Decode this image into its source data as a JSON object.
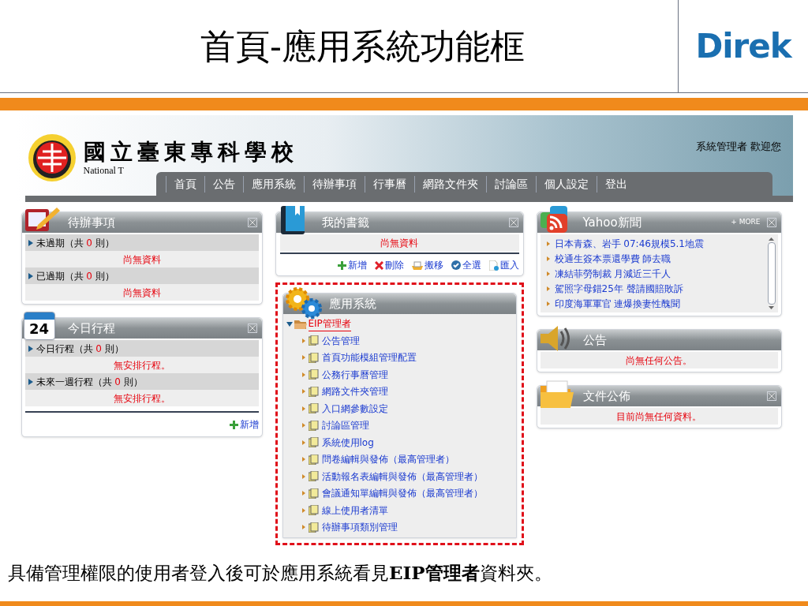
{
  "slide": {
    "title": "首頁-應用系統功能框",
    "logo": "Direk",
    "caption": "具備管理權限的使用者登入後可於應用系統看見**EIP管理者**資料夾。"
  },
  "header": {
    "school_name": "國立臺東專科學校",
    "school_name_en": "National T",
    "welcome": "系統管理者 歡迎您",
    "nav": [
      "首頁",
      "公告",
      "應用系統",
      "待辦事項",
      "行事曆",
      "網路文件夾",
      "討論區",
      "個人設定",
      "登出"
    ]
  },
  "todo": {
    "title": "待辦事項",
    "sections": [
      {
        "prefix": "未過期（共 ",
        "count": "0",
        "suffix": " 則）",
        "empty": "尚無資料"
      },
      {
        "prefix": "已過期（共 ",
        "count": "0",
        "suffix": " 則）",
        "empty": "尚無資料"
      }
    ]
  },
  "schedule": {
    "title": "今日行程",
    "calendar_day": "24",
    "sections": [
      {
        "prefix": "今日行程（共 ",
        "count": "0",
        "suffix": " 則）",
        "empty": "無安排行程。"
      },
      {
        "prefix": "未來一週行程（共 ",
        "count": "0",
        "suffix": " 則）",
        "empty": "無安排行程。"
      }
    ],
    "add": "新增"
  },
  "bookmarks": {
    "title": "我的書籤",
    "empty": "尚無資料",
    "actions": [
      {
        "kind": "add",
        "label": "新增"
      },
      {
        "kind": "delete",
        "label": "刪除"
      },
      {
        "kind": "move",
        "label": "搬移"
      },
      {
        "kind": "selectall",
        "label": "全選"
      },
      {
        "kind": "import",
        "label": "匯入"
      }
    ]
  },
  "apps": {
    "title": "應用系統",
    "highlighted": true,
    "folder": {
      "label": "EIP管理者",
      "expanded": true,
      "children": [
        {
          "label": "公告管理"
        },
        {
          "label": "首頁功能模組管理配置"
        },
        {
          "label": "公務行事曆管理"
        },
        {
          "label": "網路文件夾管理"
        },
        {
          "label": "入口網參數設定"
        },
        {
          "label": "討論區管理"
        },
        {
          "label": "系統使用log"
        },
        {
          "label": "問卷編輯與發佈（最高管理者）"
        },
        {
          "label": "活動報名表編輯與發佈（最高管理者）"
        },
        {
          "label": "會議通知單編輯與發佈（最高管理者）"
        },
        {
          "label": "線上使用者清單"
        },
        {
          "label": "待辦事項類別管理"
        }
      ]
    }
  },
  "news": {
    "title": "Yahoo新聞",
    "more": "+ MORE",
    "items": [
      "日本青森、岩手 07:46規模5.1地震",
      "校通生簽本票還學費 師去職",
      "凍結菲勞制裁 月減近三千人",
      "駕照字母錯25年 聲請國賠敗訴",
      "印度海軍軍官 連爆換妻性醜聞"
    ]
  },
  "announcements": {
    "title": "公告",
    "empty": "尚無任何公告。"
  },
  "documents": {
    "title": "文件公佈",
    "empty": "目前尚無任何資料。"
  }
}
